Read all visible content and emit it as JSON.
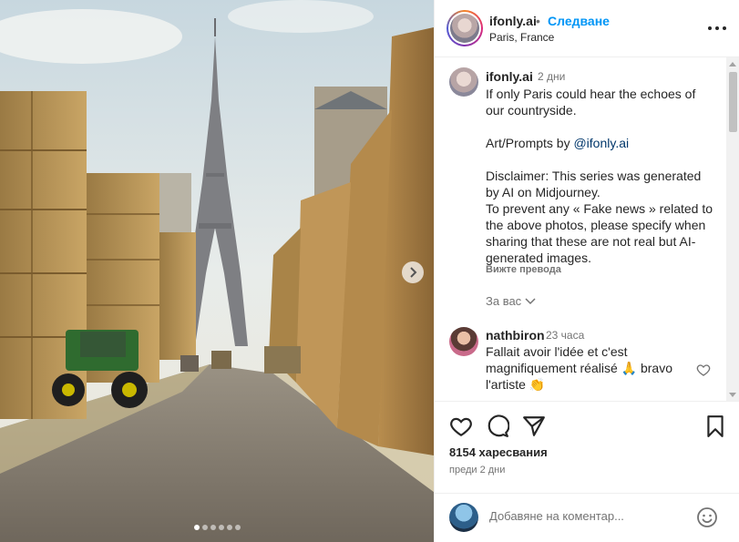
{
  "post": {
    "username": "ifonly.ai",
    "separator": "•",
    "follow_label": "Следване",
    "location": "Paris, France"
  },
  "caption": {
    "username": "ifonly.ai",
    "time": "2 дни",
    "line1": "If only Paris could hear the echoes of our countryside.",
    "credit_prefix": "Art/Prompts by ",
    "credit_mention": "@ifonly.ai",
    "disclaimer": "Disclaimer: This series was generated by AI on Midjourney.",
    "fake_news": "To prevent any « Fake news » related to the above photos, please specify when sharing that these are not real but AI-generated images.",
    "see_translation": "Вижте превода",
    "for_you": "За вас"
  },
  "comment": {
    "username": "nathbiron",
    "time": "23 часа",
    "text": "Fallait avoir l'idée et c'est magnifiquement réalisé 🙏 bravo l'artiste 👏"
  },
  "actions": {
    "likes": "8154 харесвания",
    "date": "преди 2 дни"
  },
  "add_comment": {
    "placeholder": "Добавяне на коментар..."
  },
  "carousel": {
    "total": 6,
    "active": 1
  },
  "colors": {
    "follow": "#0095f6",
    "muted": "#737373",
    "mention": "#00376b"
  }
}
